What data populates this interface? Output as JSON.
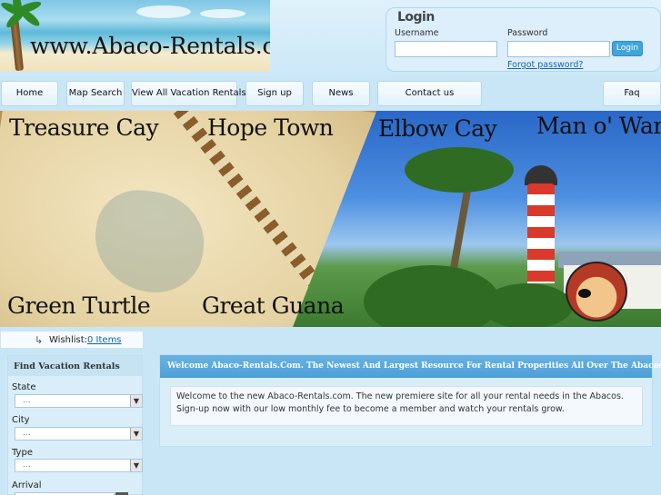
{
  "site": {
    "logo_text": "www.Abaco-Rentals.com"
  },
  "login": {
    "title": "Login",
    "username_label": "Username",
    "username_value": "",
    "password_label": "Password",
    "password_value": "",
    "login_button": "Login",
    "forgot_link": "Forgot password?"
  },
  "nav": {
    "items": [
      {
        "label": "Home"
      },
      {
        "label": "Map Search"
      },
      {
        "label": "View All Vacation Rentals"
      },
      {
        "label": "Sign up"
      },
      {
        "label": "News"
      },
      {
        "label": "Contact us"
      },
      {
        "label": "Faq"
      }
    ]
  },
  "banner": {
    "towns": [
      "Treasure Cay",
      "Hope Town",
      "Elbow Cay",
      "Man o' War",
      "Green Turtle",
      "Great Guana"
    ]
  },
  "wishlist": {
    "label": "Wishlist:",
    "link": "0 Items",
    "icon": "wishlist-icon"
  },
  "search": {
    "title": "Find Vacation Rentals",
    "fields": [
      {
        "label": "State",
        "value": "..."
      },
      {
        "label": "City",
        "value": "..."
      },
      {
        "label": "Type",
        "value": "..."
      },
      {
        "label": "Arrival",
        "value": ""
      }
    ]
  },
  "welcome": {
    "title": "Welcome Abaco-Rentals.Com. The Newest And Largest Resource For Rental Properities All Over The Abacos",
    "body": "Welcome to the new Abaco-Rentals.com. The new premiere site for all your rental needs in the Abacos. Sign-up now with our low monthly fee to become a member and watch your rentals grow."
  },
  "colors": {
    "page_bg": "#c9e6f6",
    "header_blue": "#4c9fd7",
    "link": "#1565b5",
    "login_button": "#3fa5dc"
  }
}
